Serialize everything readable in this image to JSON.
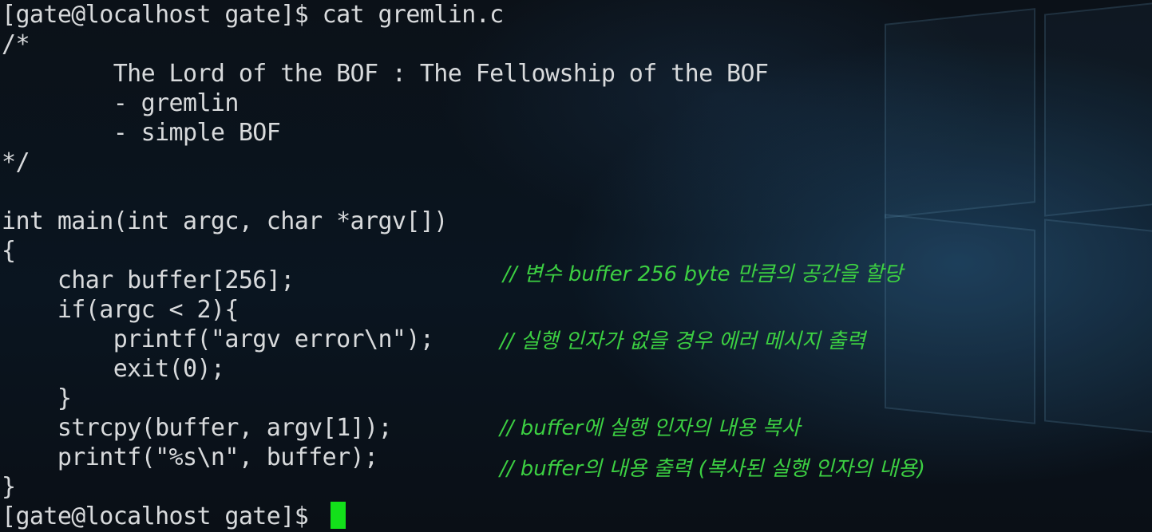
{
  "terminal": {
    "lines": [
      "[gate@localhost gate]$ cat gremlin.c",
      "/*",
      "        The Lord of the BOF : The Fellowship of the BOF",
      "        - gremlin",
      "        - simple BOF",
      "*/",
      "",
      "int main(int argc, char *argv[])",
      "{",
      "    char buffer[256];",
      "    if(argc < 2){",
      "        printf(\"argv error\\n\");",
      "        exit(0);",
      "    }",
      "    strcpy(buffer, argv[1]);",
      "    printf(\"%s\\n\", buffer);",
      "}",
      "[gate@localhost gate]$ "
    ]
  },
  "annotations": [
    "// 변수 buffer 256 byte 만큼의 공간을 할당",
    "// 실행 인자가 없을 경우 에러 메시지 출력",
    "// buffer에 실행 인자의 내용 복사",
    "// buffer의 내용 출력 (복사된 실행 인자의 내용)"
  ],
  "colors": {
    "terminal_text": "#d8dadc",
    "annotation_text": "#3ccf42",
    "cursor": "#13e01a",
    "background": "#0a0f16"
  }
}
